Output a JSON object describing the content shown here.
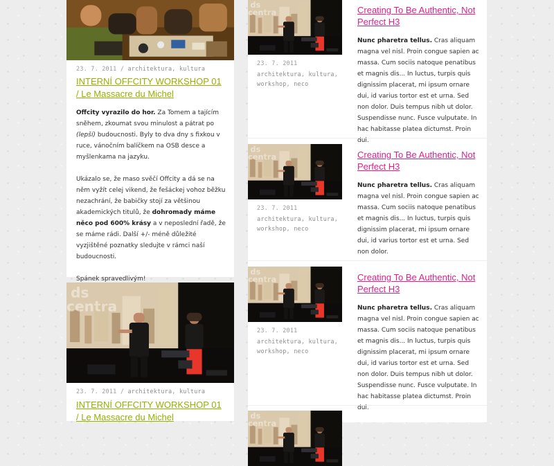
{
  "left": {
    "top_post": {
      "date": "23. 7. 2011",
      "separator": "/",
      "tags": [
        "architektura",
        "kultura"
      ],
      "title": "INTERNÍ OFFCITY WORKSHOP 01 / Le Massacre du Michel",
      "p1_bold": "Offcity vyrazilo do hor.",
      "p1_a": " Za Tomem a tajícím sněhem, zkoumat svou minulost a pátrat po ",
      "p1_em": "(lepší)",
      "p1_b": " budoucnosti. Byly to dva dny s fixkou v ruce, vánočním balíčkem na OSB desce a myšlenkama na jazyku.",
      "p2_a": "Ukázalo se, že maso svěčí Offcity a dá se na něm vyžít celej vikend, že fešáckej vohoz běžku nezachrání, že babičky stojí za většinou akademických titulů, že ",
      "p2_bold": "dohromady máme něco pod 600% krásy",
      "p2_b": " a v neposlední řadě, že se máme rádi. Další +/- méně důležité vyzjištěné poznatky sledujte v rámci naší budoucnosti.",
      "p3": "Spánek spravedlivým!"
    },
    "bottom_post": {
      "date": "23. 7. 2011",
      "separator": "/",
      "tags": [
        "architektura",
        "kultura"
      ],
      "title": "INTERNÍ OFFCITY WORKSHOP 01 / Le Massacre du Michel"
    }
  },
  "right": {
    "post1": {
      "date": "23. 7. 2011",
      "tags": [
        "architektura",
        "kultura",
        "workshop",
        "neco"
      ],
      "title": "Creating To Be Authentic, Not Perfect H3",
      "bold": "Nunc pharetra tellus.",
      "text": " Cras aliquam magna vel nisl. Proin congue sapien ac massa. Cum sociis natoque penatibus et magnis dis... In luctus, turpis quis dignissim placerat, mi ipsum ornare dui, id varius tortor est et urna. Sed non dolor. Duis tempus nibh ut dolor. Suspendisse nunc. Fusce vulputate. In hac habitasse platea dictumst. Proin dui."
    },
    "post2": {
      "date": "23. 7. 2011",
      "tags": [
        "architektura",
        "kultura",
        "workshop",
        "neco"
      ],
      "title": "Creating To Be Authentic, Not Perfect H3",
      "bold": "Nunc pharetra tellus.",
      "text": " Cras aliquam magna vel nisl. Proin congue sapien ac massa. Cum sociis natoque penatibus et magnis dis... In luctus, turpis quis dignissim placerat, mi ipsum ornare dui, id varius tortor est et urna. Sed non dolor."
    },
    "post3": {
      "date": "23. 7. 2011",
      "tags": [
        "architektura",
        "kultura",
        "workshop",
        "neco"
      ],
      "title": "Creating To Be Authentic, Not Perfect H3",
      "bold": "Nunc pharetra tellus.",
      "text": " Cras aliquam magna vel nisl. Proin congue sapien ac massa. Cum sociis natoque penatibus et magnis dis... In luctus, turpis quis dignissim placerat, mi ipsum ornare dui, id varius tortor est et urna. Sed non dolor. Duis tempus nibh ut dolor. Suspendisse nunc. Fusce vulputate. In hac habitasse platea dictumst. Proin dui."
    }
  },
  "theme": {
    "left_title_color": "#96b000",
    "right_title_color": "#e0208a",
    "meta_color": "#9a9a9a"
  }
}
